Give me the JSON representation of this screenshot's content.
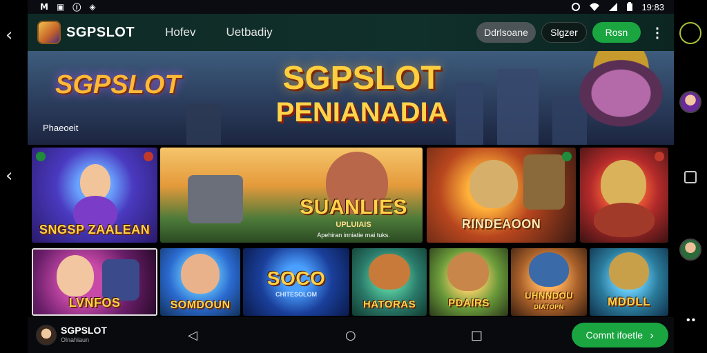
{
  "status": {
    "time": "19:83",
    "left_icons": [
      "signal-icon",
      "image-icon",
      "info-icon",
      "app-icon"
    ],
    "right_icons": [
      "location-icon",
      "wifi-icon",
      "cell-icon",
      "battery-icon"
    ],
    "left_glyphs": [
      "M",
      "▣",
      "ⓘ",
      "◈"
    ]
  },
  "header": {
    "brand": "SGPSLOT",
    "nav": [
      "Hofev",
      "Uetbadiy"
    ],
    "buttons": {
      "gray": "Ddrlsoane",
      "dark": "Slgzer",
      "green": "Rosn"
    }
  },
  "hero": {
    "left_logo": "SGPSLOT",
    "subtitle": "Phaeoeit",
    "title_line1": "SGPSLOT",
    "title_line2": "PENIANADIA"
  },
  "games_row1": [
    {
      "name": "SNGSP ZAALEAN",
      "sub": ""
    },
    {
      "name": "SUANLIES",
      "sub": "UPLUIAIS",
      "sub2": "Apehiran inniatie mai tuks."
    },
    {
      "name": "RINDEAOON",
      "sub": ""
    },
    {
      "name": "",
      "sub": ""
    }
  ],
  "games_row2": [
    {
      "name": "LVNFOS"
    },
    {
      "name": "SOMDOUN"
    },
    {
      "name": "SOCO",
      "sub": "CHITESOLOM"
    },
    {
      "name": "HATORAS"
    },
    {
      "name": "PDAIRS"
    },
    {
      "name": "UHNNDOU",
      "name2": "DIATOPN"
    },
    {
      "name": "MDDLL"
    }
  ],
  "bottom": {
    "brand": "SGPSLOT",
    "tagline": "Olnahiaun",
    "cta": "Comnt ifoetle",
    "nav_glyphs": {
      "back": "◁",
      "home": "○",
      "recents": "□",
      "cta_arrow": "›"
    }
  },
  "rail": {
    "left_chevron": "‹",
    "right_dots": "••"
  },
  "colors": {
    "accent": "#1aa540",
    "header_bg": "#0f2a26",
    "title_gold": "#ffcf3e"
  }
}
